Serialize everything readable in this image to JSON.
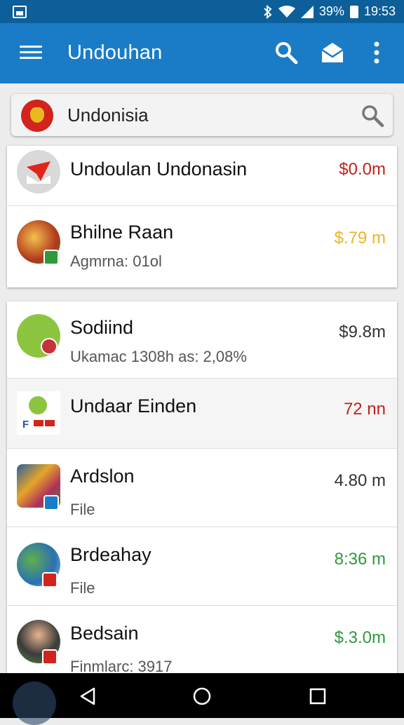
{
  "status_bar": {
    "battery": "39%",
    "time": "19:53"
  },
  "app_bar": {
    "title": "Undouhan"
  },
  "search": {
    "text": "Undonisia"
  },
  "group1": [
    {
      "title": "Undoulan Undonasin",
      "subtitle": "",
      "value": "$0.0m",
      "value_color": "#c0231b"
    },
    {
      "title": "Bhilne Raan",
      "subtitle": "Agmrna: 01ol",
      "value": "$.79 m",
      "value_color": "#e8b52a"
    }
  ],
  "group2": [
    {
      "title": "Sodiind",
      "subtitle": "Ukamac 1308h as: 2,08%",
      "value": "$9.8m",
      "value_color": "#333333"
    },
    {
      "title": "Undaar Einden",
      "subtitle": "",
      "value": "72 nn",
      "value_color": "#c0231b"
    },
    {
      "title": "Ardslon",
      "subtitle": "File",
      "value": "4.80 m",
      "value_color": "#333333"
    },
    {
      "title": "Brdeahay",
      "subtitle": "File",
      "value": "8:36 m",
      "value_color": "#2e9a3a"
    },
    {
      "title": "Bedsain",
      "subtitle": "Finmlarc: 3917",
      "value": "$.3.0m",
      "value_color": "#2e9a3a"
    }
  ],
  "icons": [
    "gallery-icon",
    "bluetooth-icon",
    "wifi-icon",
    "signal-icon",
    "battery-icon",
    "menu-icon",
    "search-icon",
    "mail-open-icon",
    "more-vert-icon",
    "emblem-icon",
    "search-icon",
    "gmail-icon",
    "back-icon",
    "home-icon",
    "recents-icon"
  ]
}
